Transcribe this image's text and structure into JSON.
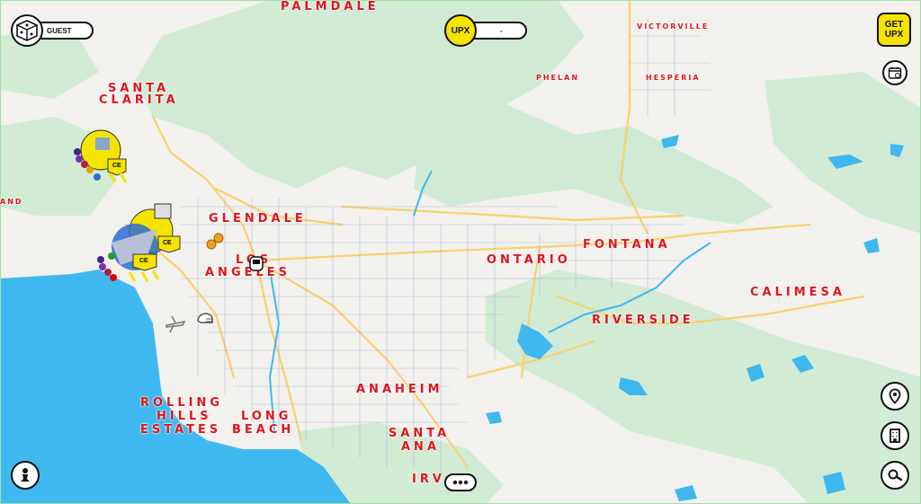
{
  "app": {
    "user": {
      "name": "GUEST",
      "avatar_icon": "dice-icon"
    },
    "upx": {
      "badge": "UPX",
      "balance": "-"
    },
    "get_upx": {
      "line1": "GET",
      "line2": "UPX"
    }
  },
  "colors": {
    "water": "#3fb8f0",
    "land": "#f2f1ed",
    "park": "#cfead4",
    "city_label": "#e0141b",
    "upx_yellow": "#f5e400",
    "highway": "#f7d26a",
    "road": "#9aa6e0"
  },
  "map": {
    "cities": [
      {
        "id": "palmdale",
        "name": "PALMDALE",
        "size": "big"
      },
      {
        "id": "victorville",
        "name": "VICTORVILLE",
        "size": "small"
      },
      {
        "id": "phelan",
        "name": "PHELAN",
        "size": "small"
      },
      {
        "id": "hesperia",
        "name": "HESPERIA",
        "size": "small"
      },
      {
        "id": "santa1",
        "name": "SANTA",
        "size": "big"
      },
      {
        "id": "clarita",
        "name": "CLARITA",
        "size": "big"
      },
      {
        "id": "glendale",
        "name": "GLENDALE",
        "size": "big"
      },
      {
        "id": "los",
        "name": "LOS",
        "size": "big"
      },
      {
        "id": "angeles",
        "name": "ANGELES",
        "size": "big"
      },
      {
        "id": "fontana",
        "name": "FONTANA",
        "size": "big"
      },
      {
        "id": "ontario",
        "name": "ONTARIO",
        "size": "big"
      },
      {
        "id": "calimesa",
        "name": "CALIMESA",
        "size": "big"
      },
      {
        "id": "riverside",
        "name": "RIVERSIDE",
        "size": "big"
      },
      {
        "id": "anaheim",
        "name": "ANAHEIM",
        "size": "big"
      },
      {
        "id": "rolling",
        "name": "ROLLING",
        "size": "big"
      },
      {
        "id": "hills",
        "name": "HILLS",
        "size": "big"
      },
      {
        "id": "estates",
        "name": "ESTATES",
        "size": "big"
      },
      {
        "id": "long",
        "name": "LONG",
        "size": "big"
      },
      {
        "id": "beach",
        "name": "BEACH",
        "size": "big"
      },
      {
        "id": "santa2",
        "name": "SANTA",
        "size": "big"
      },
      {
        "id": "ana",
        "name": "ANA",
        "size": "big"
      },
      {
        "id": "irv",
        "name": "IRV",
        "size": "big"
      },
      {
        "id": "and",
        "name": "AND",
        "size": "small"
      }
    ],
    "markers": {
      "ce_badge": "CE"
    }
  },
  "controls": {
    "calendar_icon": "calendar-icon",
    "location_icon": "location-pin-icon",
    "buildings_icon": "building-icon",
    "search_icon": "search-icon",
    "pawn_icon": "pawn-icon",
    "more_icon": "more-dots-icon"
  }
}
